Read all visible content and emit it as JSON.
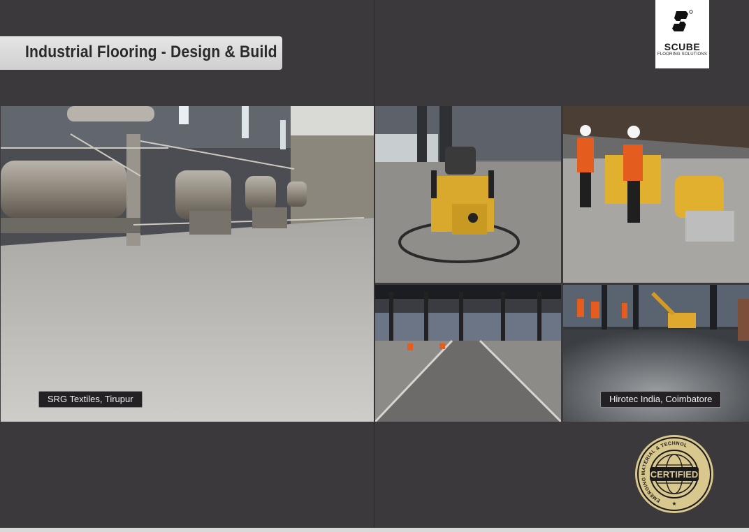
{
  "header": {
    "title": "Industrial Flooring - Design & Build"
  },
  "logo": {
    "name": "SCUBE",
    "subtitle": "FLOORING SOLUTIONS",
    "registered": "®"
  },
  "photos": [
    {
      "id": "main",
      "caption": "SRG Textiles, Tirupur"
    },
    {
      "id": "power-trowel"
    },
    {
      "id": "grinding-workers"
    },
    {
      "id": "empty-warehouse"
    },
    {
      "id": "polishing-floor",
      "caption": "Hirotec India, Coimbatore"
    }
  ],
  "seal": {
    "center_text": "CERTIFIED",
    "ring_text_top": "EMERGING MATERIAL & TECHNOLOGY SYSTEMS",
    "star": "★"
  },
  "colors": {
    "background": "#3b393c",
    "seal_gold": "#d6c48a",
    "banner": "#dcdcdc"
  }
}
